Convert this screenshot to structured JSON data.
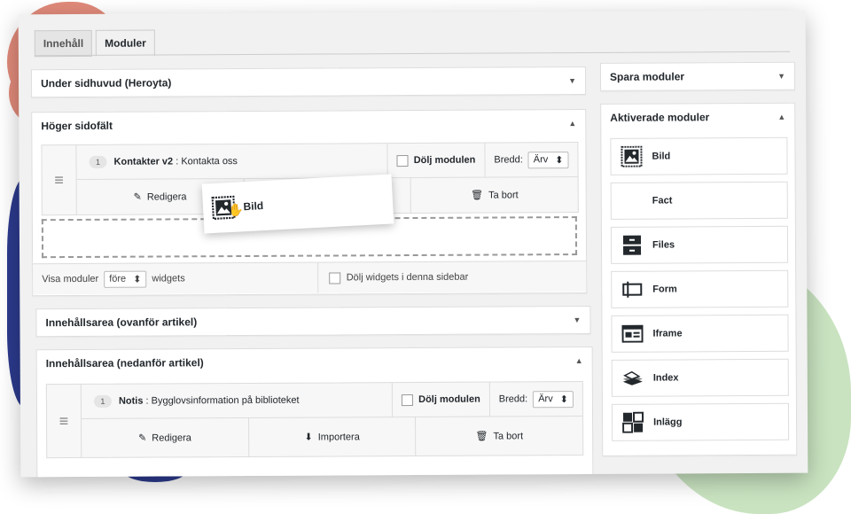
{
  "tabs": [
    {
      "label": "Innehåll"
    },
    {
      "label": "Moduler"
    }
  ],
  "sections": {
    "under_header": {
      "title": "Under sidhuvud (Heroyta)"
    },
    "right_sidebar": {
      "title": "Höger sidofält",
      "module": {
        "num": "1",
        "type": "Kontakter v2",
        "sep": " : ",
        "name": "Kontakta oss",
        "hide_label": "Dölj modulen",
        "width_label": "Bredd:",
        "width_value": "Ärv",
        "edit": "Redigera",
        "delete": "Ta bort"
      },
      "show_modules_label": "Visa moduler",
      "show_modules_value": "före",
      "widgets_label": "widgets",
      "hide_widgets_label": "Dölj widgets i denna sidebar"
    },
    "content_above": {
      "title": "Innehållsarea (ovanför artikel)"
    },
    "content_below": {
      "title": "Innehållsarea (nedanför artikel)",
      "module": {
        "num": "1",
        "type": "Notis",
        "sep": " : ",
        "name": "Bygglovsinformation på biblioteket",
        "hide_label": "Dölj modulen",
        "width_label": "Bredd:",
        "width_value": "Ärv",
        "edit": "Redigera",
        "import": "Importera",
        "delete": "Ta bort"
      }
    }
  },
  "sidebar": {
    "save_title": "Spara moduler",
    "active_title": "Aktiverade moduler",
    "items": [
      {
        "label": "Bild",
        "icon": "image-icon"
      },
      {
        "label": "Fact",
        "icon": ""
      },
      {
        "label": "Files",
        "icon": "files-icon"
      },
      {
        "label": "Form",
        "icon": "form-icon"
      },
      {
        "label": "Iframe",
        "icon": "iframe-icon"
      },
      {
        "label": "Index",
        "icon": "index-icon"
      },
      {
        "label": "Inlägg",
        "icon": "posts-icon"
      }
    ]
  },
  "drag_card": {
    "label": "Bild"
  }
}
